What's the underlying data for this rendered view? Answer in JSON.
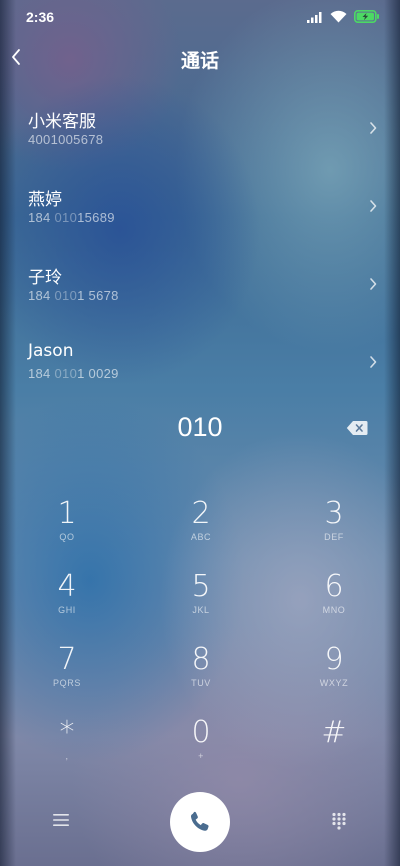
{
  "status_bar": {
    "time": "2:36",
    "icons": [
      "signal-icon",
      "wifi-icon",
      "battery-charging-icon"
    ],
    "battery_color": "#4cd964"
  },
  "header": {
    "title": "通话",
    "back_icon": "chevron-left-icon"
  },
  "contacts": [
    {
      "name": "小米客服",
      "number_parts": [
        "4001005678",
        "",
        ""
      ]
    },
    {
      "name": "燕婷",
      "number_parts": [
        "184 ",
        "010",
        "15689"
      ]
    },
    {
      "name": "子玲",
      "number_parts": [
        "184 ",
        "010",
        "1 5678"
      ]
    },
    {
      "name": "Jason",
      "number_parts": [
        "184 ",
        "010",
        "1 0029"
      ]
    }
  ],
  "dialer": {
    "dialed_number": "010",
    "delete_icon": "backspace-icon"
  },
  "keypad": [
    {
      "digit": "1",
      "letters": "QO"
    },
    {
      "digit": "2",
      "letters": "ABC"
    },
    {
      "digit": "3",
      "letters": "DEF"
    },
    {
      "digit": "4",
      "letters": "GHI"
    },
    {
      "digit": "5",
      "letters": "JKL"
    },
    {
      "digit": "6",
      "letters": "MNO"
    },
    {
      "digit": "7",
      "letters": "PQRS"
    },
    {
      "digit": "8",
      "letters": "TUV"
    },
    {
      "digit": "9",
      "letters": "WXYZ"
    },
    {
      "digit": "*",
      "letters": ","
    },
    {
      "digit": "0",
      "letters": "+"
    },
    {
      "digit": "#",
      "letters": ""
    }
  ],
  "bottom_bar": {
    "menu_icon": "menu-icon",
    "call_icon": "phone-icon",
    "call_icon_color": "#4a6c8f",
    "dialpad_icon": "dialpad-icon"
  }
}
